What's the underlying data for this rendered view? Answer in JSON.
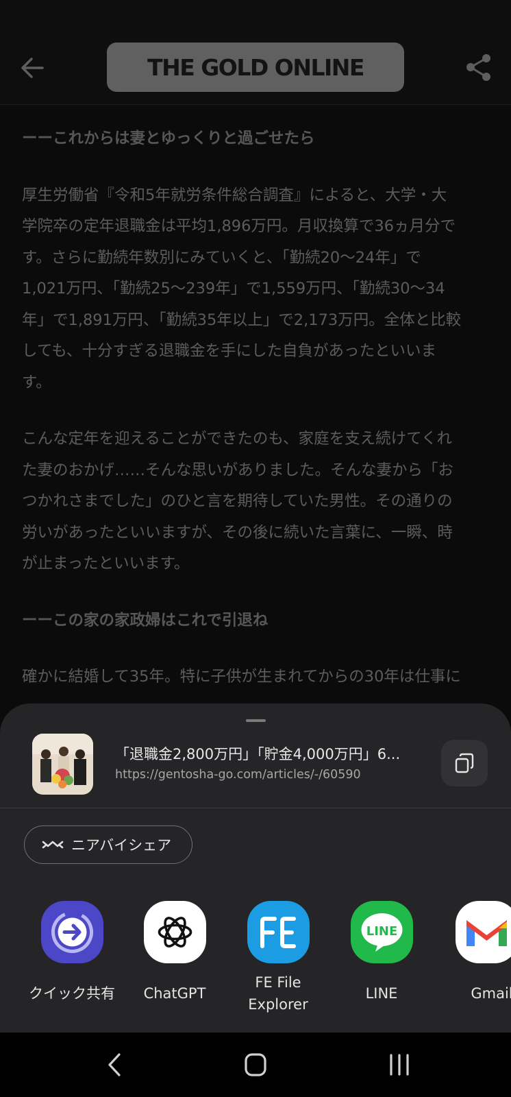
{
  "app_bar": {
    "logo_text": "THE GOLD ONLINE",
    "back_icon": "arrow-left-icon",
    "share_icon": "share-icon"
  },
  "article": {
    "heading1": "ーーこれからは妻とゆっくりと過ごせたら",
    "para1_lines": [
      "厚生労働省『令和5年就労条件総合調査』によると、大学・大",
      "学院卒の定年退職金は平均1,896万円。月収換算で36ヵ月分で",
      "す。さらに勤続年数別にみていくと、「勤続20～24年」で",
      "1,021万円、「勤続25～239年」で1,559万円、「勤続30～34",
      "年」で1,891万円、「勤続35年以上」で2,173万円。全体と比較",
      "しても、十分すぎる退職金を手にした自負があったといいま",
      "す。"
    ],
    "para2_lines": [
      "こんな定年を迎えることができたのも、家庭を支え続けてくれ",
      "た妻のおかげ……そんな思いがありました。そんな妻から「お",
      "つかれさまでした」のひと言を期待していた男性。その通りの",
      "労いがあったといいますが、その後に続いた言葉に、一瞬、時",
      "が止まったといいます。"
    ],
    "heading2": "ーーこの家の家政婦はこれで引退ね",
    "para3_line": "確かに結婚して35年。特に子供が生まれてからの30年は仕事に"
  },
  "share_sheet": {
    "title": "「退職金2,800万円」「貯金4,000万円」6...",
    "url": "https://gentosha-go.com/articles/-/60590",
    "copy_icon": "copy-icon",
    "nearby_share_label": "ニアバイシェア",
    "apps": [
      {
        "label_lines": [
          "クイック共有"
        ],
        "icon": "quick-share-icon",
        "color": "#4b47c6"
      },
      {
        "label_lines": [
          "ChatGPT"
        ],
        "icon": "chatgpt-icon",
        "color": "#ffffff"
      },
      {
        "label_lines": [
          "FE File",
          "Explorer"
        ],
        "icon": "fe-file-explorer-icon",
        "color": "#1b9ce3"
      },
      {
        "label_lines": [
          "LINE"
        ],
        "icon": "line-icon",
        "color": "#22b94b"
      },
      {
        "label_lines": [
          "Gmail"
        ],
        "icon": "gmail-icon",
        "color": "#ffffff"
      }
    ]
  },
  "nav_bar": {
    "back": "nav-back-icon",
    "home": "nav-home-icon",
    "recents": "nav-recents-icon"
  },
  "colors": {
    "background": "#0b0b0b",
    "sheet": "#252527",
    "accent_line_green": "#22b94b"
  }
}
